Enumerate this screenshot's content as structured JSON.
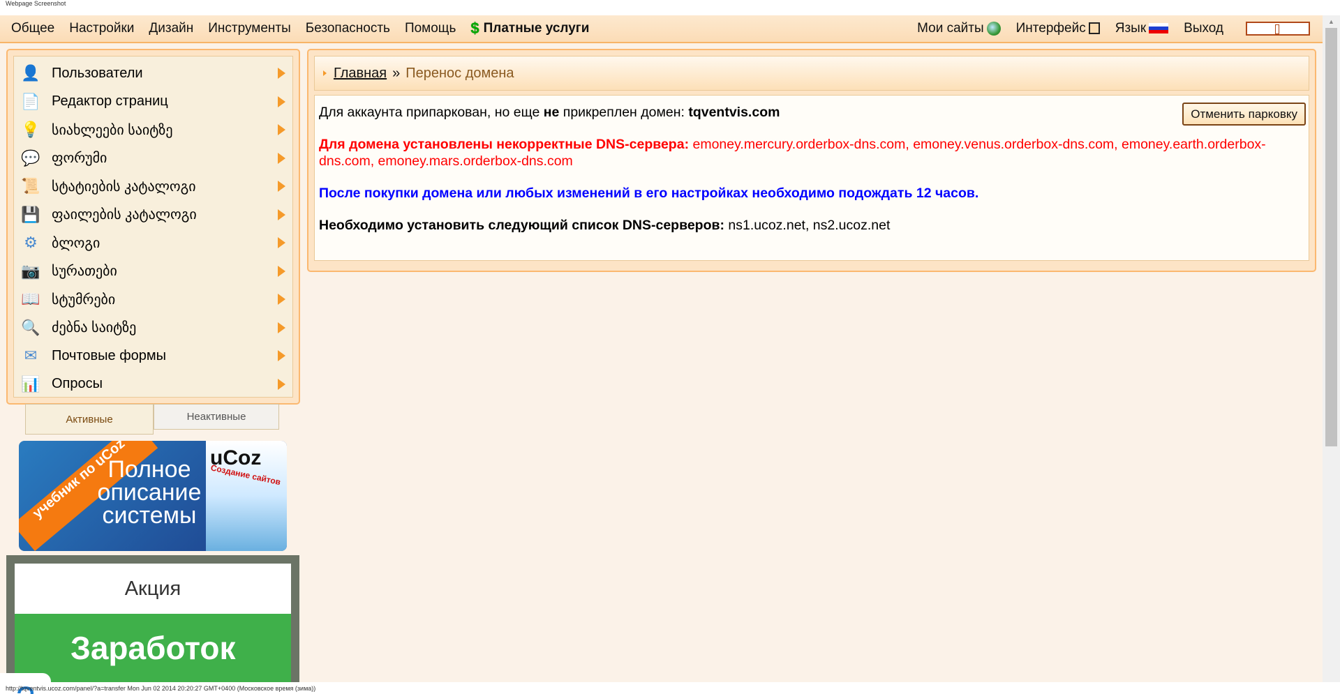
{
  "caption": "Webpage Screenshot",
  "topbar": {
    "left": [
      "Общее",
      "Настройки",
      "Дизайн",
      "Инструменты",
      "Безопасность",
      "Помощь"
    ],
    "paid": "Платные услуги",
    "my_sites": "Мои сайты",
    "interface": "Интерфейс",
    "language": "Язык",
    "logout": "Выход"
  },
  "sidebar": {
    "items": [
      {
        "label": "Пользователи",
        "icon": "user-icon"
      },
      {
        "label": "Редактор страниц",
        "icon": "page-icon"
      },
      {
        "label": "სიახლეები საიტზე",
        "icon": "bulb-icon"
      },
      {
        "label": "ფორუმი",
        "icon": "speech-bubble-icon"
      },
      {
        "label": "სტატიების კატალოგი",
        "icon": "scroll-icon"
      },
      {
        "label": "ფაილების კატალოგი",
        "icon": "floppy-icon"
      },
      {
        "label": "ბლოგი",
        "icon": "gear-icon"
      },
      {
        "label": "სურათები",
        "icon": "camera-icon"
      },
      {
        "label": "სტუმრები",
        "icon": "book-icon"
      },
      {
        "label": "ძებნა საიტზე",
        "icon": "search-icon"
      },
      {
        "label": "Почтовые формы",
        "icon": "envelope-icon"
      },
      {
        "label": "Опросы",
        "icon": "bar-chart-icon"
      }
    ]
  },
  "tabs": {
    "active": "Активные",
    "inactive": "Неактивные"
  },
  "banner1": {
    "ribbon": "учебник по uCoz",
    "text": "Полное описание системы",
    "book_title": "uCoz",
    "book_sub": "Создание сайтов"
  },
  "banner2": {
    "top": "Акция",
    "bottom": "Заработок"
  },
  "help": "?",
  "breadcrumb": {
    "home": "Главная",
    "sep": "»",
    "current": "Перенос домена"
  },
  "content": {
    "line1_a": "Для аккаунта припаркован, но еще ",
    "line1_b": "не",
    "line1_c": " прикреплен домен: ",
    "domain": "tqventvis.com",
    "cancel_button": "Отменить парковку",
    "dns_label": "Для домена установлены некорректные DNS-сервера:",
    "dns_values": " emoney.mercury.orderbox-dns.com, emoney.venus.orderbox-dns.com, emoney.earth.orderbox-dns.com, emoney.mars.orderbox-dns.com",
    "wait_notice": "После покупки домена или любых изменений в его настройках необходимо подождать 12 часов.",
    "required_label": "Необходимо установить следующий список DNS-серверов:",
    "required_values": " ns1.ucoz.net, ns2.ucoz.net"
  },
  "status": "http://tqventvis.ucoz.com/panel/?a=transfer Mon Jun 02 2014 20:20:27 GMT+0400 (Московское время (зима))"
}
